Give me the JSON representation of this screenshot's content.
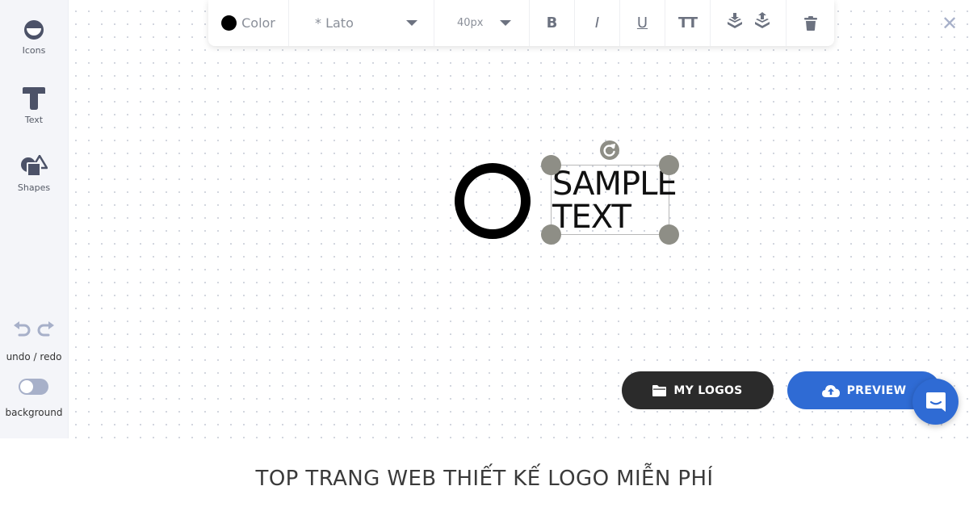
{
  "sidebar": {
    "icons_label": "Icons",
    "text_label": "Text",
    "shapes_label": "Shapes",
    "undo_redo_label": "undo / redo",
    "background_label": "background",
    "background_toggle_on": false
  },
  "toolbar": {
    "color_label": "Color",
    "color_value": "#000000",
    "font_value": "* Lato",
    "size_value": "40px",
    "bold_label": "B",
    "italic_label": "I",
    "underline_label": "U",
    "uppercase_label": "TT"
  },
  "close_label": "✕",
  "canvas": {
    "text_line_1": "SAMPLE",
    "text_line_2": "TEXT"
  },
  "buttons": {
    "my_logos": "MY LOGOS",
    "preview": "PREVIEW"
  },
  "headline": "TOP TRANG WEB THIẾT KẾ LOGO MIỄN PHÍ",
  "colors": {
    "accent_blue": "#2f6bd4",
    "dark_button": "#2b2b2b",
    "handle_gray": "#8e8e86",
    "sidebar_icon": "#4c5268",
    "sidebar_bg": "#f4f5f9"
  },
  "icons": [
    "icons-tool-icon",
    "text-tool-icon",
    "shapes-tool-icon",
    "undo-icon",
    "redo-icon",
    "layer-down-icon",
    "layer-up-icon",
    "trash-icon",
    "folder-icon",
    "cloud-upload-icon",
    "chat-icon",
    "rotate-icon"
  ]
}
